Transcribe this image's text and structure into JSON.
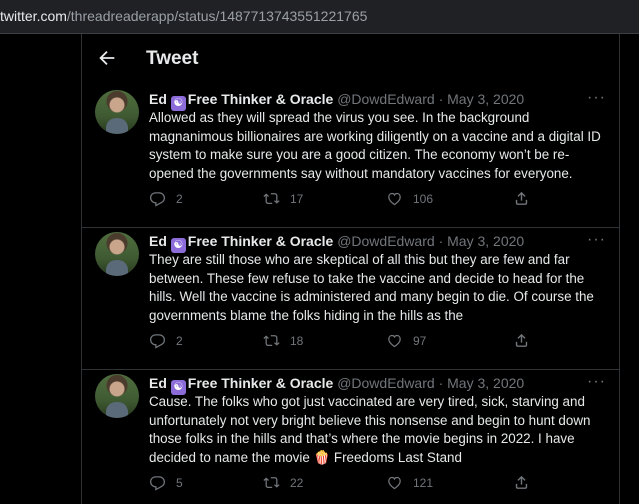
{
  "browser": {
    "url_domain": "twitter.com",
    "url_path": "/threadreaderapp/status/1487713743551221765"
  },
  "header": {
    "title": "Tweet"
  },
  "tweets": [
    {
      "name": "Ed",
      "badge": "☯",
      "name_rest": "Free Thinker & Oracle",
      "handle": "@DowdEdward",
      "sep": "·",
      "date": "May 3, 2020",
      "text": "Allowed as they will spread the virus you see. In the background magnanimous billionaires are working diligently on a vaccine and a digital ID system to make sure you are a good citizen. The economy won’t be re-opened the governments say without mandatory vaccines for everyone.",
      "replies": "2",
      "retweets": "17",
      "likes": "106"
    },
    {
      "name": "Ed",
      "badge": "☯",
      "name_rest": "Free Thinker & Oracle",
      "handle": "@DowdEdward",
      "sep": "·",
      "date": "May 3, 2020",
      "text": "They are still those who are skeptical of all this but they are few and far between. These few refuse to take the vaccine and decide to head for the hills. Well the vaccine is administered and many begin to die. Of course the governments blame the folks hiding in the hills as the",
      "replies": "2",
      "retweets": "18",
      "likes": "97"
    },
    {
      "name": "Ed",
      "badge": "☯",
      "name_rest": "Free Thinker & Oracle",
      "handle": "@DowdEdward",
      "sep": "·",
      "date": "May 3, 2020",
      "text": "Cause. The folks who got just vaccinated are very tired, sick, starving and unfortunately not very bright believe this nonsense and begin to hunt down those folks in the hills and that’s where the movie begins in 2022. I have decided to name the movie 🍿 Freedoms Last Stand",
      "replies": "5",
      "retweets": "22",
      "likes": "121"
    }
  ],
  "colors": {
    "background": "#000000",
    "text": "#e7e9ea",
    "muted": "#71767b",
    "border": "#2f3336",
    "badge": "#8c6cd9"
  },
  "icons": [
    "back-arrow-icon",
    "more-icon",
    "reply-icon",
    "retweet-icon",
    "like-icon",
    "share-icon"
  ]
}
